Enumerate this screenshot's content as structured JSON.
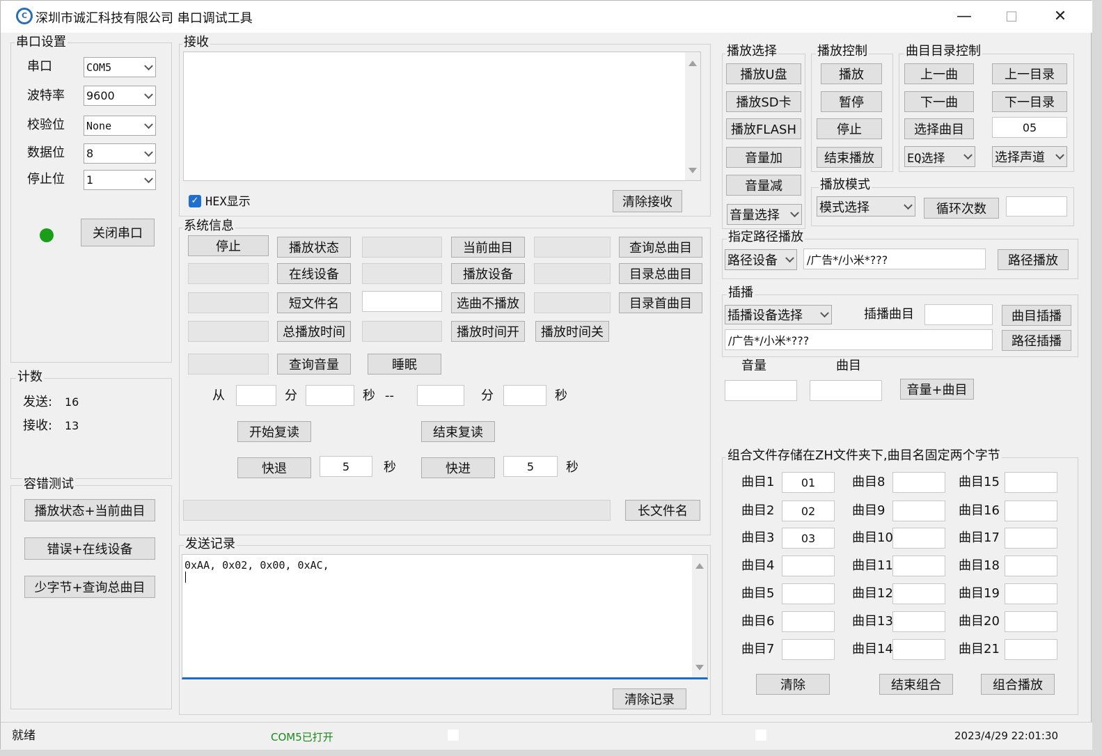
{
  "window": {
    "title": "深圳市诚汇科技有限公司 串口调试工具",
    "icon": "app-logo-icon",
    "minimize": "—",
    "maximize": "☐",
    "close": "✕"
  },
  "serial": {
    "title": "串口设置",
    "port_label": "串口",
    "port": "COM5",
    "baud_label": "波特率",
    "baud": "9600",
    "parity_label": "校验位",
    "parity": "None",
    "data_label": "数据位",
    "data": "8",
    "stop_label": "停止位",
    "stop": "1",
    "close_btn": "关闭串口",
    "led_color": "#1a9e1a"
  },
  "count": {
    "title": "计数",
    "send_label": "发送:",
    "send": "16",
    "recv_label": "接收:",
    "recv": "13"
  },
  "fault": {
    "title": "容错测试",
    "b1": "播放状态+当前曲目",
    "b2": "错误+在线设备",
    "b3": "少字节+查询总曲目"
  },
  "receive": {
    "title": "接收",
    "hex_label": "HEX显示",
    "hex_checked": true,
    "clear": "清除接收"
  },
  "sysinfo": {
    "title": "系统信息",
    "stop": "停止",
    "play_state": "播放状态",
    "cur_track": "当前曲目",
    "query_total": "查询总曲目",
    "online_dev": "在线设备",
    "play_dev": "播放设备",
    "dir_total": "目录总曲目",
    "short_name": "短文件名",
    "select_no_play": "选曲不播放",
    "dir_first": "目录首曲目",
    "total_time": "总播放时间",
    "time_on": "播放时间开",
    "time_off": "播放时间关",
    "query_vol": "查询音量",
    "sleep": "睡眠",
    "from": "从",
    "min1": "分",
    "sec1": "秒",
    "dash": "--",
    "min2": "分",
    "sec2": "秒",
    "start_repeat": "开始复读",
    "end_repeat": "结束复读",
    "rewind": "快退",
    "rewind_val": "5",
    "rewind_unit": "秒",
    "forward": "快进",
    "forward_val": "5",
    "forward_unit": "秒",
    "long_name": "长文件名"
  },
  "sendlog": {
    "title": "发送记录",
    "content": "0xAA, 0x02, 0x00, 0xAC,",
    "clear": "清除记录"
  },
  "playsel": {
    "title": "播放选择",
    "udisk": "播放U盘",
    "sd": "播放SD卡",
    "flash": "播放FLASH",
    "vol_up": "音量加",
    "vol_down": "音量减",
    "vol_select": "音量选择"
  },
  "playctl": {
    "title": "播放控制",
    "play": "播放",
    "pause": "暂停",
    "stop": "停止",
    "end": "结束播放"
  },
  "dirctl": {
    "title": "曲目目录控制",
    "prev": "上一曲",
    "prev_dir": "上一目录",
    "next": "下一曲",
    "next_dir": "下一目录",
    "select": "选择曲目",
    "select_val": "05",
    "eq": "EQ选择",
    "channel": "选择声道"
  },
  "mode": {
    "title": "播放模式",
    "select": "模式选择",
    "loop": "循环次数"
  },
  "path": {
    "title": "指定路径播放",
    "device": "路径设备",
    "value": "/广告*/小米*???",
    "btn": "路径播放"
  },
  "insert": {
    "title": "插播",
    "device": "插播设备选择",
    "track_label": "插播曲目",
    "track_btn": "曲目插播",
    "path_value": "/广告*/小米*???",
    "path_btn": "路径插播"
  },
  "voltrack": {
    "vol_label": "音量",
    "track_label": "曲目",
    "btn": "音量+曲目"
  },
  "combo": {
    "title": "组合文件存储在ZH文件夹下,曲目名固定两个字节",
    "labels": [
      "曲目1",
      "曲目2",
      "曲目3",
      "曲目4",
      "曲目5",
      "曲目6",
      "曲目7",
      "曲目8",
      "曲目9",
      "曲目10",
      "曲目11",
      "曲目12",
      "曲目13",
      "曲目14",
      "曲目15",
      "曲目16",
      "曲目17",
      "曲目18",
      "曲目19",
      "曲目20",
      "曲目21"
    ],
    "values": [
      "01",
      "02",
      "03",
      "",
      "",
      "",
      "",
      "",
      "",
      "",
      "",
      "",
      "",
      "",
      "",
      "",
      "",
      "",
      "",
      "",
      ""
    ],
    "clear": "清除",
    "end": "结束组合",
    "play": "组合播放"
  },
  "status": {
    "ready": "就绪",
    "port": "COM5已打开",
    "time": "2023/4/29 22:01:30"
  }
}
